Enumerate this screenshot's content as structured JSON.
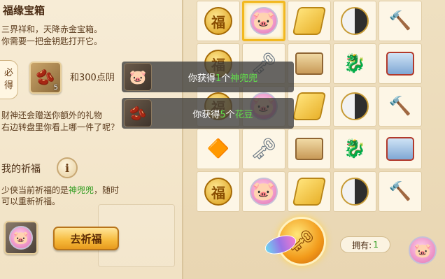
{
  "left": {
    "title": "福缘宝箱",
    "intro_line1": "三界祥和，天降赤金宝箱。",
    "intro_line2": "你需要一把金钥匙打开它。",
    "must_label_1": "必",
    "must_label_2": "得",
    "must_item_count": "5",
    "must_reward_text": "和300点阴",
    "gift_line1": "财神还会赠送你额外的礼物",
    "gift_line2": "右边转盘里你看上哪一件了呢？",
    "prayer_title": "我的祈福",
    "info_glyph": "i",
    "prayer_line1_prefix": "少侠当前祈福的是",
    "prayer_target": "神兜兜",
    "prayer_line1_suffix": "，随时",
    "prayer_line2": "可以重新祈福。",
    "pray_button": "去祈福"
  },
  "grid": {
    "cells": [
      "gold-coin",
      "pink-pig",
      "cheese",
      "yin-yang",
      "hammer",
      "gold-coin",
      "silver-key",
      "scroll",
      "blue-dragon",
      "treasure-chest",
      "gold-coin",
      "pink-pig",
      "cheese",
      "yin-yang",
      "hammer",
      "orange-gem",
      "silver-key",
      "scroll",
      "blue-dragon",
      "treasure-chest",
      "gold-coin",
      "pink-pig",
      "cheese",
      "yin-yang",
      "hammer"
    ],
    "selected_index": 1
  },
  "toasts": [
    {
      "prefix": "你获得",
      "count": "1",
      "unit": "个",
      "item": "神兜兜"
    },
    {
      "prefix": "你获得",
      "count": "5",
      "unit": "个",
      "item": "花豆"
    }
  ],
  "bottom": {
    "own_label": "拥有:",
    "own_count": "1"
  },
  "colors": {
    "highlight_green": "#62e34a",
    "selected_border": "#f2b820",
    "button_orange": "#f6b93a"
  }
}
